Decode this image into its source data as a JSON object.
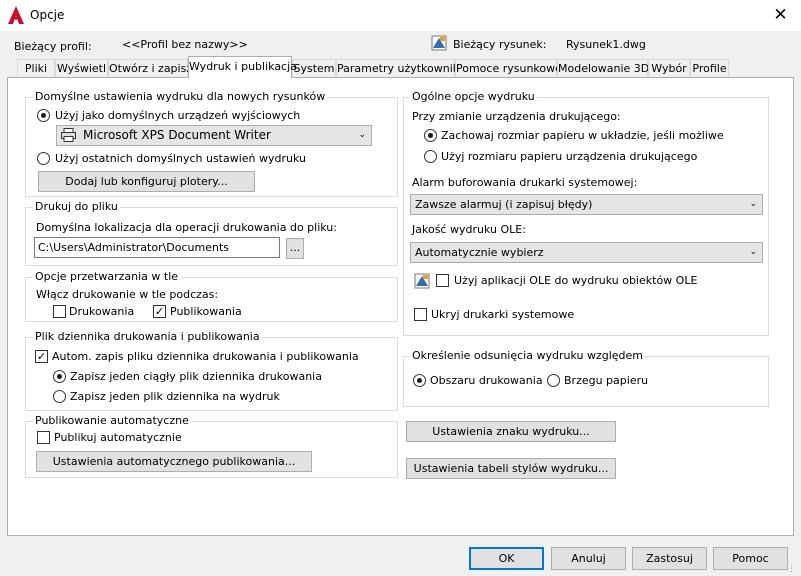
{
  "window": {
    "title": "Opcje",
    "close": "✕"
  },
  "profile": {
    "label": "Bieżący profil:",
    "value": "<<Profil bez nazwy>>"
  },
  "drawing": {
    "label": "Bieżący rysunek:",
    "value": "Rysunek1.dwg"
  },
  "tabs": [
    "Pliki",
    "Wyświetl",
    "Otwórz i zapisz",
    "Wydruk i publikacja",
    "System",
    "Parametry użytkownika",
    "Pomoce rysunkowe",
    "Modelowanie 3D",
    "Wybór",
    "Profile"
  ],
  "default_print": {
    "title": "Domyślne ustawienia wydruku dla nowych rysunków",
    "use_device_label": "Użyj jako domyślnych urządzeń wyjściowych",
    "device_value": "Microsoft XPS Document Writer",
    "use_last_label": "Użyj ostatnich domyślnych ustawień wydruku",
    "add_plotter_btn": "Dodaj lub konfiguruj plotery..."
  },
  "print_to_file": {
    "title": "Drukuj do pliku",
    "location_label": "Domyślna lokalizacja dla operacji drukowania do pliku:",
    "path": "C:\\Users\\Administrator\\Documents",
    "browse": "..."
  },
  "background": {
    "title": "Opcje przetwarzania w tle",
    "enable_label": "Włącz drukowanie w tle podczas:",
    "plotting_label": "Drukowania",
    "publishing_label": "Publikowania",
    "plotting_checked": false,
    "publishing_checked": true
  },
  "log": {
    "title": "Plik dziennika drukowania i publikowania",
    "auto_save_label": "Autom. zapis pliku dziennika drukowania i publikowania",
    "continuous_label": "Zapisz jeden ciągły plik dziennika drukowania",
    "per_plot_label": "Zapisz jeden plik dziennika na wydruk",
    "auto_save_checked": true
  },
  "auto_publish": {
    "title": "Publikowanie automatyczne",
    "checkbox_label": "Publikuj automatycznie",
    "settings_btn": "Ustawienia automatycznego publikowania..."
  },
  "general": {
    "title": "Ogólne opcje wydruku",
    "change_device_label": "Przy zmianie urządzenia drukującego:",
    "keep_size_label": "Zachowaj rozmiar papieru w układzie, jeśli możliwe",
    "use_device_size_label": "Użyj rozmiaru papieru urządzenia drukującego",
    "spool_label": "Alarm buforowania drukarki systemowej:",
    "spool_value": "Zawsze alarmuj (i zapisuj błędy)",
    "ole_quality_label": "Jakość wydruku OLE:",
    "ole_quality_value": "Automatycznie wybierz",
    "use_ole_label": "Użyj aplikacji OLE do wydruku obiektów OLE",
    "hide_printers_label": "Ukryj drukarki systemowe"
  },
  "offset": {
    "title": "Określenie odsunięcia wydruku względem",
    "printable_label": "Obszaru drukowania",
    "edge_label": "Brzegu papieru"
  },
  "stamp_btn": "Ustawienia znaku wydruku...",
  "style_btn": "Ustawienia tabeli stylów wydruku...",
  "footer": {
    "ok": "OK",
    "cancel": "Anuluj",
    "apply": "Zastosuj",
    "help": "Pomoc"
  }
}
